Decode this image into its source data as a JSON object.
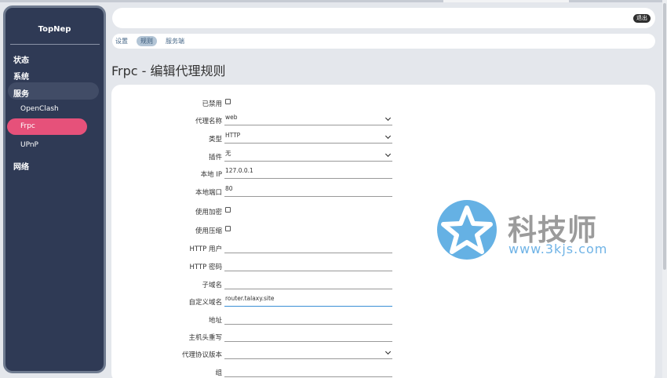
{
  "sidebar": {
    "brand": "TopNep",
    "menu": [
      {
        "label": "状态"
      },
      {
        "label": "系统"
      },
      {
        "label": "服务"
      },
      {
        "label": "网络"
      }
    ],
    "submenu": [
      {
        "label": "OpenClash"
      },
      {
        "label": "Frpc"
      },
      {
        "label": "UPnP"
      }
    ]
  },
  "header": {
    "logout_label": "退出"
  },
  "tabs": [
    {
      "label": "设置"
    },
    {
      "label": "规则"
    },
    {
      "label": "服务端"
    }
  ],
  "page": {
    "title": "Frpc - 编辑代理规则"
  },
  "form": {
    "disabled_label": "已禁用",
    "proxy_name_label": "代理名称",
    "proxy_name_value": "web",
    "type_label": "类型",
    "type_value": "HTTP",
    "plugin_label": "插件",
    "plugin_value": "无",
    "local_ip_label": "本地 IP",
    "local_ip_value": "127.0.0.1",
    "local_port_label": "本地端口",
    "local_port_value": "80",
    "encrypt_label": "使用加密",
    "compress_label": "使用压缩",
    "http_user_label": "HTTP 用户",
    "http_user_value": "",
    "http_pass_label": "HTTP 密码",
    "http_pass_value": "",
    "subdomain_label": "子域名",
    "subdomain_value": "",
    "custom_domain_label": "自定义域名",
    "custom_domain_value": "router.talaxy.site",
    "location_label": "地址",
    "location_value": "",
    "host_rewrite_label": "主机头重写",
    "host_rewrite_value": "",
    "proxy_protocol_label": "代理协议版本",
    "proxy_protocol_value": "",
    "group_label": "组",
    "group_value": ""
  },
  "watermark": {
    "text": "科技师",
    "url": "www.3kjs.com"
  },
  "colors": {
    "sidebar_bg": "#2f3a55",
    "active_pill": "#e6517a",
    "active_tab": "#b3c5d6"
  }
}
